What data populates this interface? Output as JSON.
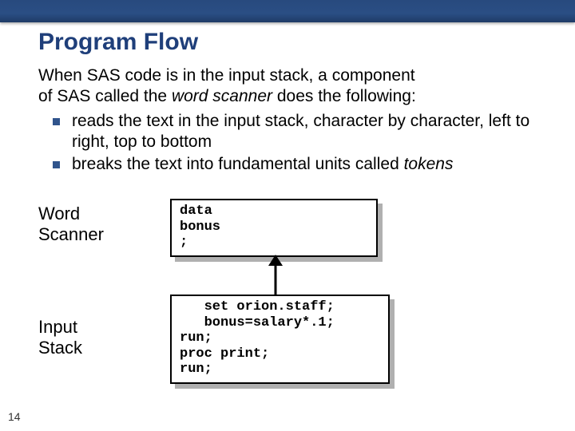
{
  "slide": {
    "title": "Program Flow",
    "intro_line1": "When SAS code is in the input stack, a component",
    "intro_line2_a": "of SAS called the ",
    "intro_line2_em": "word scanner",
    "intro_line2_b": " does the following:",
    "bullet1": "reads the text in the input stack, character by character, left to right, top to bottom",
    "bullet2_a": "breaks the text into fundamental units called ",
    "bullet2_em": "tokens"
  },
  "diagram": {
    "label_word_scanner": "Word\nScanner",
    "label_input_stack": "Input\nStack",
    "code_top": "data\nbonus\n;",
    "code_bottom": "   set orion.staff;\n   bonus=salary*.1;\nrun;\nproc print;\nrun;"
  },
  "page_number": "14"
}
